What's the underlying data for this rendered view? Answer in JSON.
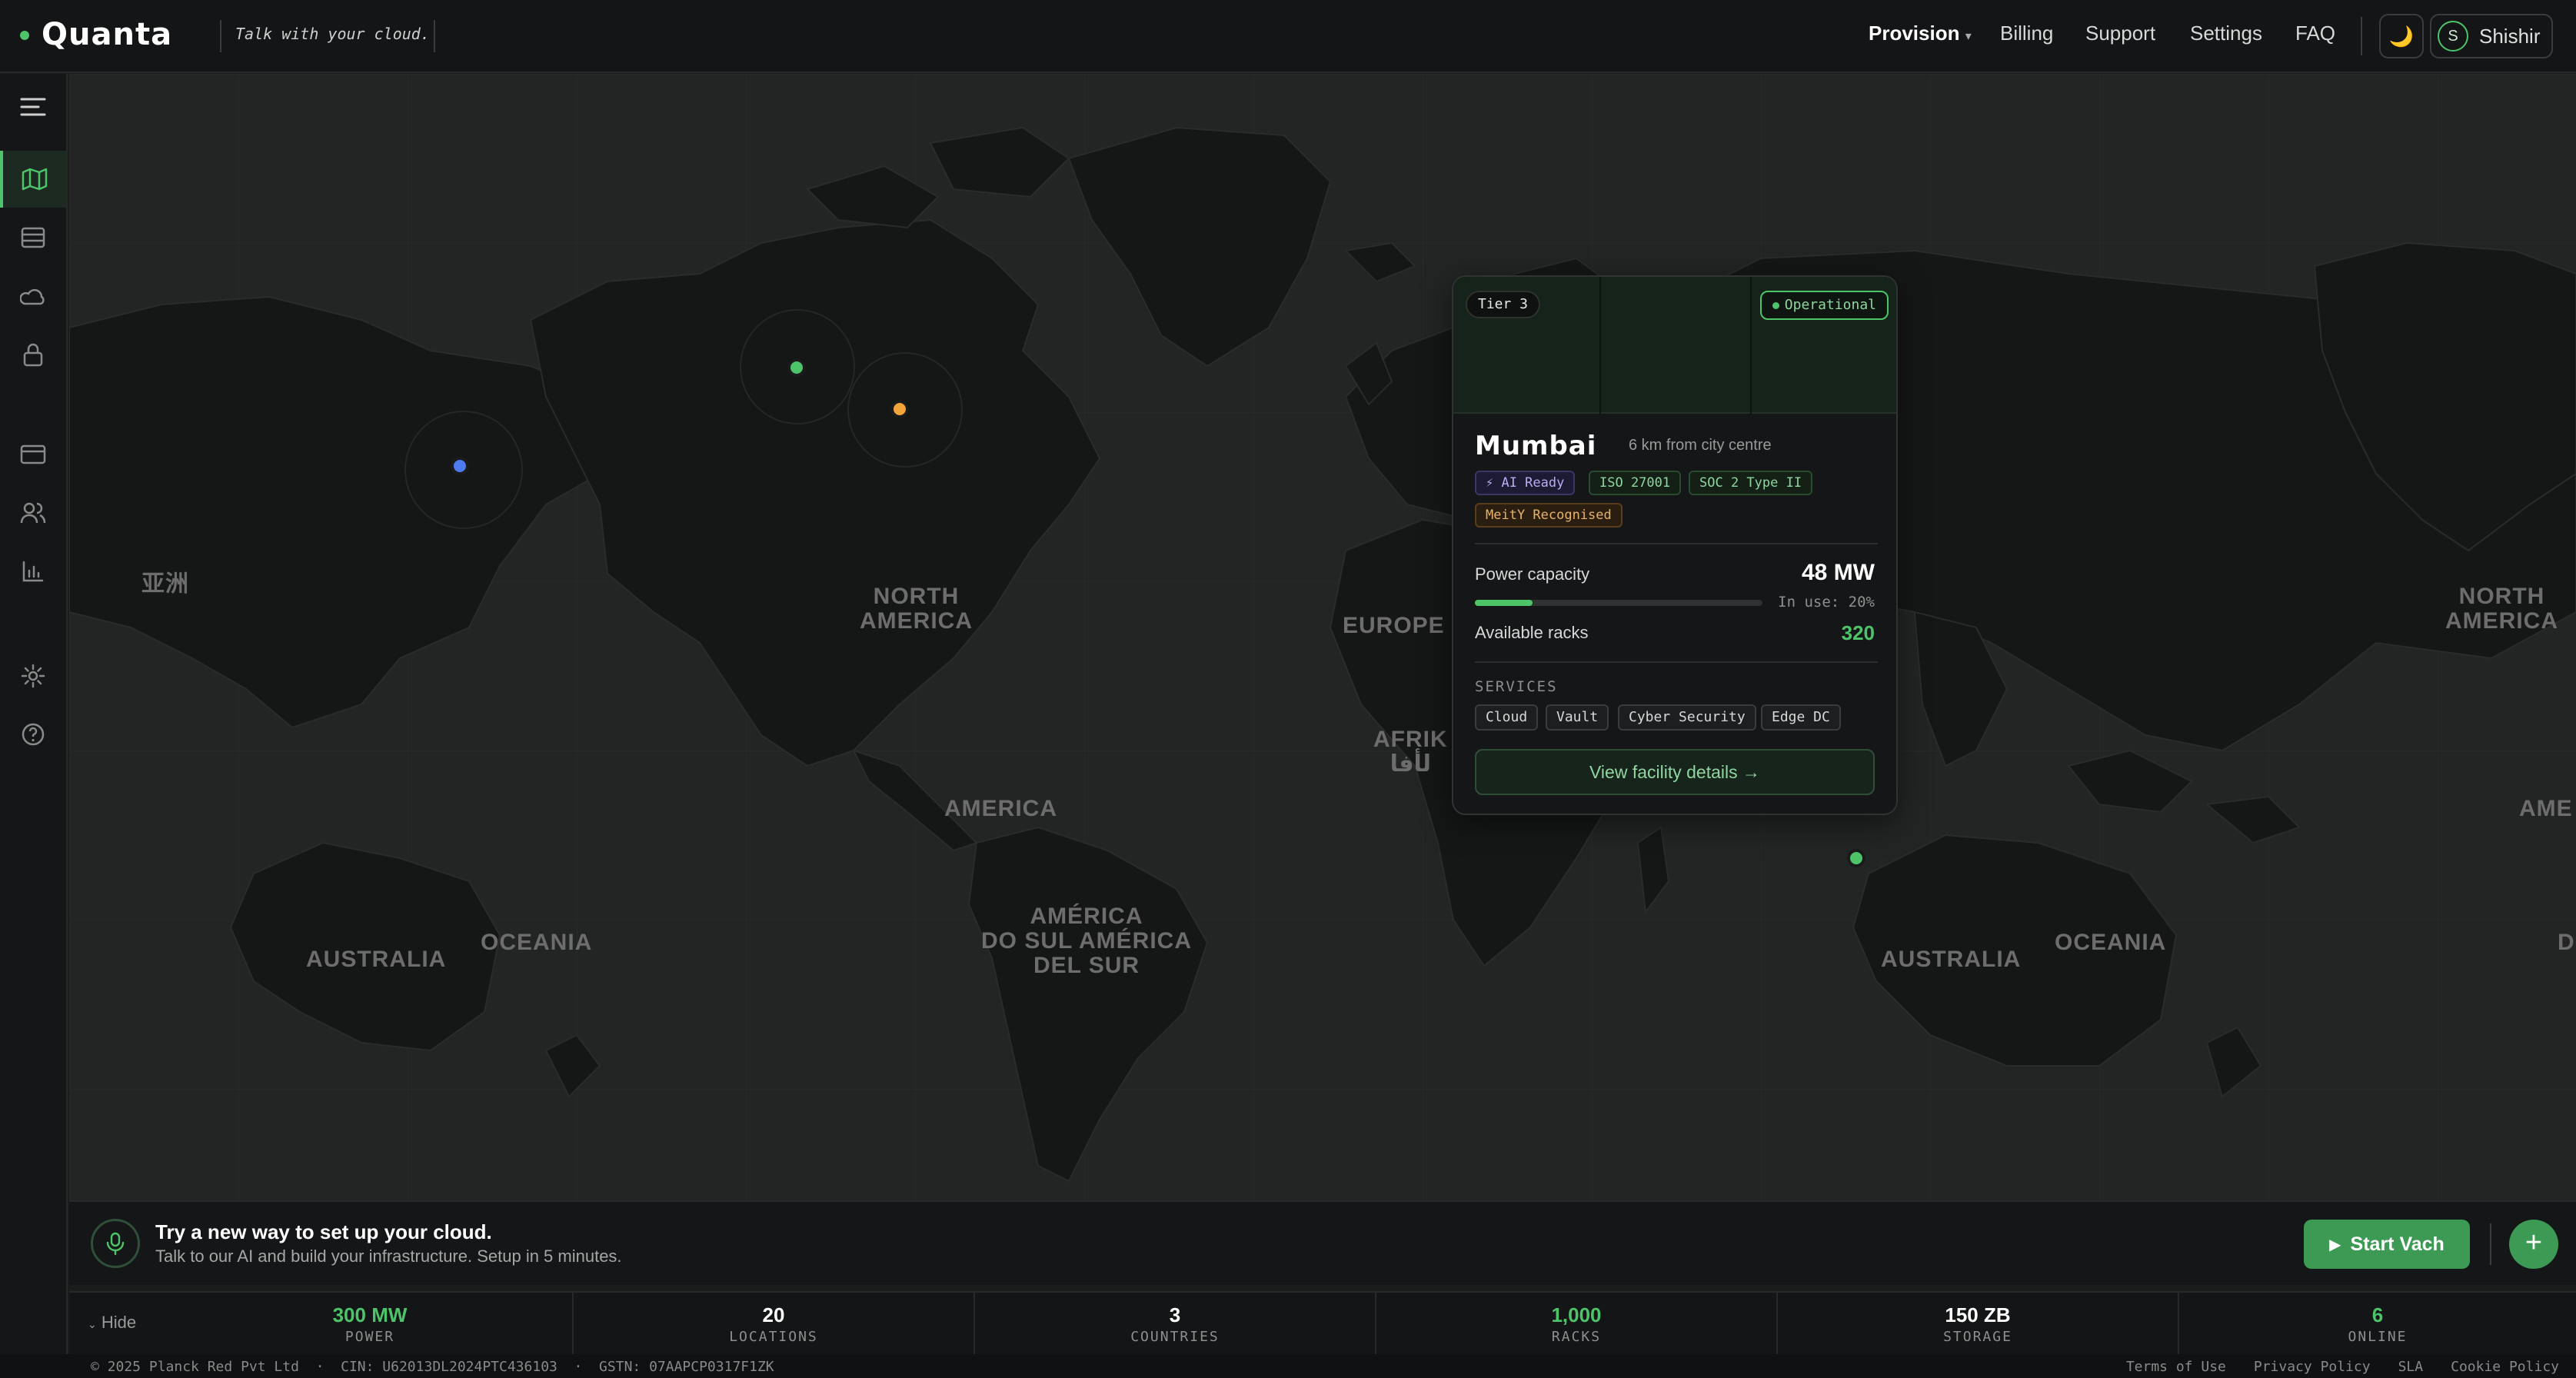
{
  "app": {
    "brand": "Quanta",
    "tagline": "Talk with your cloud."
  },
  "nav": {
    "items": [
      {
        "label": "Provision",
        "has_dropdown": true
      },
      {
        "label": "Billing"
      },
      {
        "label": "Support"
      },
      {
        "label": "Settings"
      },
      {
        "label": "FAQ"
      }
    ]
  },
  "user": {
    "initial": "S",
    "name": "Shishir"
  },
  "sidebar": {
    "icons": [
      "menu-icon",
      "map-icon",
      "list-icon",
      "cloud-icon",
      "lock-icon",
      "card-icon",
      "users-icon",
      "chart-icon",
      "gear-icon",
      "help-icon"
    ]
  },
  "map": {
    "labels": {
      "na": "NORTH\nAMERICA",
      "na2": "NORTH\nAMERICA",
      "europe": "EUROPE",
      "africa": "AFRIK\nلأفا",
      "america": "AMERICA",
      "am2": "AME",
      "sa": "AMÉRICA\nDO SUL AMÉRICA\nDEL SUR",
      "aus1": "AUSTRALIA",
      "oce1": "OCEANIA",
      "aus2": "AUSTRALIA",
      "oce2": "OCEANIA",
      "asia": "亚洲",
      "d": "D"
    },
    "markers": [
      {
        "name": "blue",
        "color": "#4d7cf0"
      },
      {
        "name": "green",
        "color": "#4ec46a"
      },
      {
        "name": "orange",
        "color": "#f2a33a"
      },
      {
        "name": "green",
        "color": "#4ec46a"
      }
    ]
  },
  "popup": {
    "tier": "Tier 3",
    "status": "Operational",
    "city": "Mumbai",
    "distance": "6 km from city centre",
    "tags": [
      "⚡ AI Ready",
      "ISO 27001",
      "SOC 2 Type II",
      "MeitY Recognised"
    ],
    "power_label": "Power capacity",
    "power_value": "48 MW",
    "in_use": "In use: 20%",
    "in_use_fraction": 0.2,
    "racks_label": "Available racks",
    "racks_value": "320",
    "services_title": "SERVICES",
    "services": [
      "Cloud",
      "Vault",
      "Cyber Security",
      "Edge DC"
    ],
    "details_label": "View facility details →"
  },
  "banner": {
    "title": "Try a new way to set up your cloud.",
    "subtitle": "Talk to our AI and build your infrastructure. Setup in 5 minutes.",
    "start_label": "Start Vach",
    "plus": "+"
  },
  "stats": {
    "hide_label": "Hide",
    "items": [
      {
        "value": "300 MW",
        "label": "POWER",
        "color": "#4ec46a"
      },
      {
        "value": "20",
        "label": "LOCATIONS",
        "color": "#ffffff"
      },
      {
        "value": "3",
        "label": "COUNTRIES",
        "color": "#ffffff"
      },
      {
        "value": "1,000",
        "label": "RACKS",
        "color": "#4ec46a"
      },
      {
        "value": "150 ZB",
        "label": "STORAGE",
        "color": "#ffffff"
      },
      {
        "value": "6",
        "label": "ONLINE",
        "color": "#4ec46a"
      }
    ]
  },
  "footer": {
    "left": "© 2025 Planck Red Pvt Ltd  ·  CIN: U62013DL2024PTC436103  ·  GSTN: 07AAPCP0317F1ZK",
    "links": [
      "Terms of Use",
      "Privacy Policy",
      "SLA",
      "Cookie Policy"
    ]
  }
}
